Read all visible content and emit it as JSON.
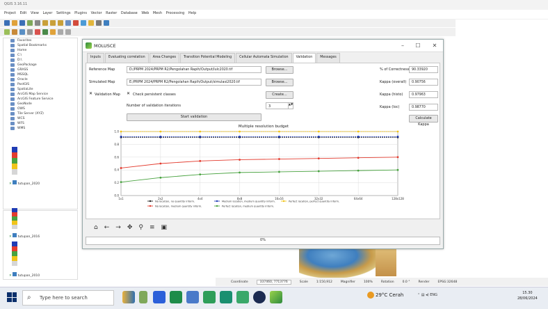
{
  "qgis": {
    "title": "QGIS 3.16.11",
    "menu": [
      "Project",
      "Edit",
      "View",
      "Layer",
      "Settings",
      "Plugins",
      "Vector",
      "Raster",
      "Database",
      "Web",
      "Mesh",
      "Processing",
      "Help"
    ],
    "browser_items": [
      "Favorites",
      "Spatial Bookmarks",
      "Home",
      "C:\\",
      "D:\\",
      "GeoPackage",
      "GRASS",
      "MSSQL",
      "Oracle",
      "PostGIS",
      "SpatiaLite",
      "ArcGIS Map Service",
      "ArcGIS Feature Service",
      "GeoNode",
      "OWS",
      "Tile Server (XYZ)",
      "WCS",
      "WFS",
      "WMS"
    ],
    "layers": [
      {
        "name": "tutupan_2020",
        "legend_colors": [
          "#1f3cb4",
          "#e33b2e",
          "#48a23f",
          "#f0c419",
          "#d6d6d6"
        ]
      },
      {
        "name": "tutupan_2016",
        "legend_colors": [
          "#1f3cb4",
          "#e33b2e",
          "#48a23f",
          "#f0c419",
          "#d6d6d6"
        ]
      },
      {
        "name": "tutupan_2010",
        "legend_colors": [
          "#1f3cb4",
          "#e33b2e",
          "#48a23f",
          "#f0c419",
          "#d6d6d6"
        ]
      }
    ],
    "status": {
      "coordinate_label": "Coordinate",
      "coordinate": "337460, 7713776",
      "scale_label": "Scale",
      "scale": "1:150,912",
      "magnifier_label": "Magnifier",
      "magnifier": "100%",
      "rotation_label": "Rotation",
      "rotation": "0.0 °",
      "render_label": "Render",
      "crs": "EPSG:32648"
    }
  },
  "dialog": {
    "title": "MOLUSCE",
    "tabs": [
      "Inputs",
      "Evaluating correlation",
      "Area Changes",
      "Transition Potential Modeling",
      "Cellular Automata Simulation",
      "Validation",
      "Messages"
    ],
    "active_tab": "Validation",
    "reference_label": "Reference Map",
    "reference_path": "D:/PRPM 2024/PRPM R2/Pengolahan Rapih/Output/lulc2020.tif",
    "browse1": "Browse...",
    "simulated_label": "Simulated Map",
    "simulated_path": "E:/PRPM 2024/PRPM R2/Pengolahan Rapih/Output/simulasi2020.tif",
    "browse2": "Browse...",
    "validation_map_label": "Validation Map",
    "check_persistent_label": "Check persistent classes",
    "create_btn": "Create...",
    "iterations_label": "Number of validation iterations",
    "iterations_value": "3",
    "start_btn": "Start validation",
    "pct_correctness_label": "% of Correctness",
    "pct_correctness": "90.33920",
    "kappa_overall_label": "Kappa (overall)",
    "kappa_overall": "0.90756",
    "kappa_histo_label": "Kappa (histo)",
    "kappa_histo": "0.97963",
    "kappa_loc_label": "Kappa (loc)",
    "kappa_loc": "0.98770",
    "calc_kappa_btn": "Calculate Kappa",
    "progress": 0.0,
    "progress_text": "0%"
  },
  "chart_data": {
    "type": "line",
    "title": "Multiple resolution budget",
    "x": [
      1,
      2,
      3,
      4,
      5,
      6,
      7,
      8
    ],
    "x_ticks": [
      "1x1",
      "2x2",
      "4x4",
      "8x8",
      "16x16",
      "32x32",
      "64x64",
      "128x128"
    ],
    "ylim": [
      0,
      1.0
    ],
    "y_ticks": [
      "0.0",
      "0.2",
      "0.4",
      "0.6",
      "0.8",
      "1.0"
    ],
    "grid": true,
    "legend_position": "bottom",
    "series": [
      {
        "name": "No location, no quantity inform.",
        "color": "#222222",
        "values": [
          0.91,
          0.91,
          0.91,
          0.91,
          0.91,
          0.91,
          0.91,
          0.91
        ]
      },
      {
        "name": "No location, medium quantity inform.",
        "color": "#e33b2e",
        "values": [
          0.43,
          0.5,
          0.54,
          0.56,
          0.57,
          0.58,
          0.59,
          0.6
        ]
      },
      {
        "name": "Medium location, medium quantity inform.",
        "color": "#1f3cb4",
        "values": [
          0.92,
          0.92,
          0.92,
          0.92,
          0.92,
          0.92,
          0.92,
          0.92
        ]
      },
      {
        "name": "Perfect location, medium quantity inform.",
        "color": "#48a23f",
        "values": [
          0.21,
          0.28,
          0.33,
          0.36,
          0.37,
          0.38,
          0.39,
          0.4
        ]
      },
      {
        "name": "Perfect location, perfect quantity inform.",
        "color": "#f0c419",
        "values": [
          1.0,
          1.0,
          1.0,
          1.0,
          1.0,
          1.0,
          1.0,
          1.0
        ]
      }
    ]
  },
  "taskbar": {
    "search_placeholder": "Type here to search",
    "weather": "29°C Cerah",
    "lang": "ENG",
    "time": "15.30",
    "date": "28/06/2024"
  }
}
